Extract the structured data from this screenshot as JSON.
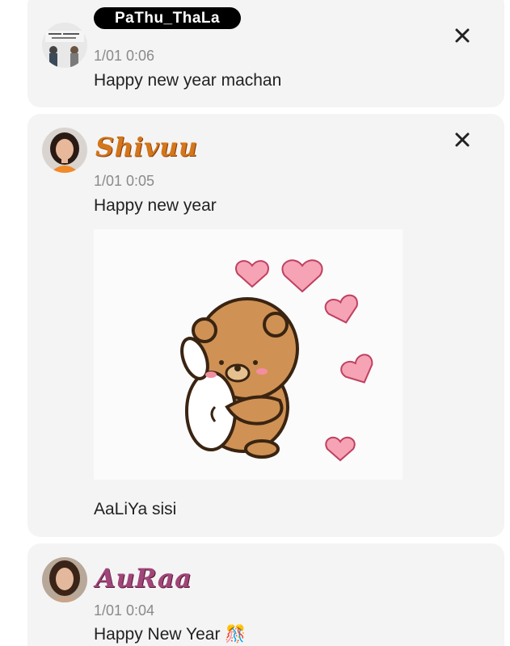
{
  "posts": [
    {
      "name": "PaThu_ThaLa",
      "time": "1/01 0:06",
      "message": "Happy new year machan",
      "avatar_icon": "avatar-photo-icon",
      "close_icon": "close-icon"
    },
    {
      "name": "Shivuu",
      "time": "1/01 0:05",
      "message": "Happy new year",
      "sticker_icon": "bear-hugging-sticker",
      "caption": "AaLiYa sisi",
      "name_color": "#d4761c",
      "avatar_icon": "avatar-photo-icon",
      "close_icon": "close-icon"
    },
    {
      "name": "AuRaa",
      "time": "1/01 0:04",
      "message": "Happy New Year",
      "emoji": "🎊",
      "name_color": "#a0457a",
      "avatar_icon": "avatar-photo-icon"
    }
  ]
}
